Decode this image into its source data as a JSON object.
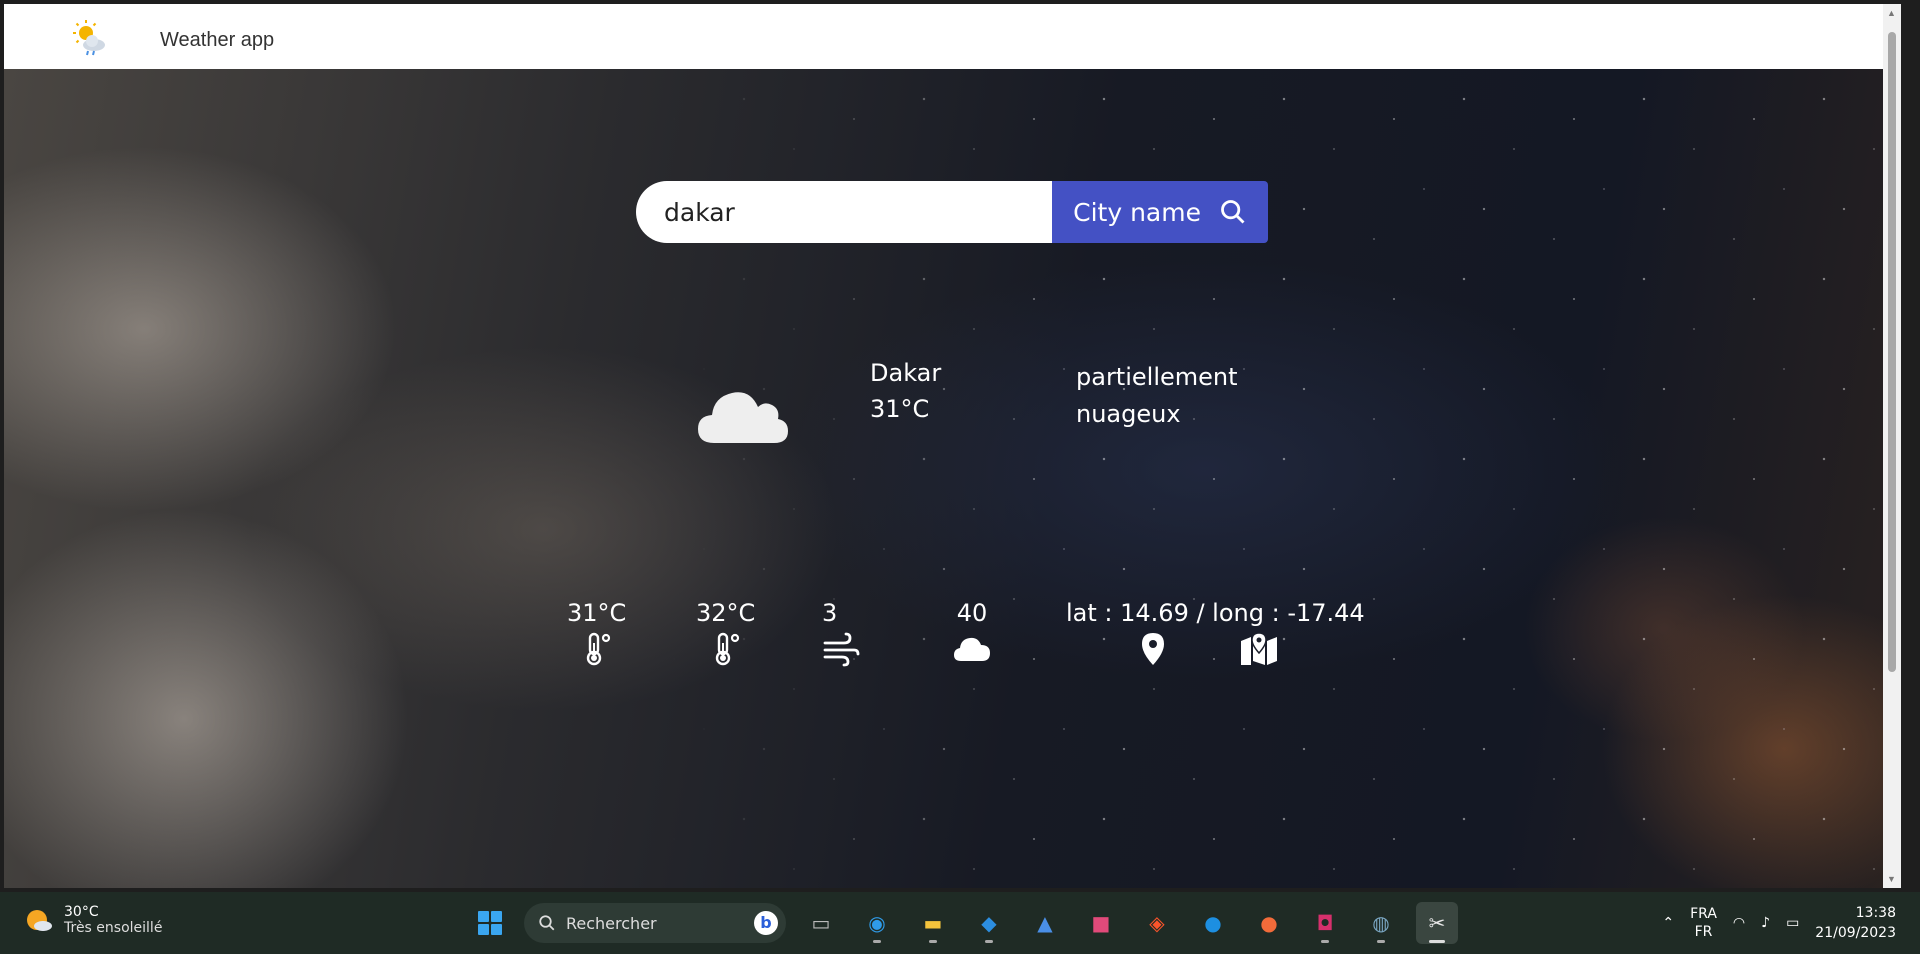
{
  "header": {
    "title": "Weather app",
    "logo_icon": "sun-cloud-icon"
  },
  "search": {
    "value": "dakar",
    "button_label": "City name",
    "button_color": "#4451c4"
  },
  "current": {
    "city": "Dakar",
    "temperature": "31°C",
    "description": "partiellement nuageux",
    "icon": "cloud-icon"
  },
  "stats": {
    "temp_min": "31°C",
    "temp_max": "32°C",
    "wind": "3",
    "clouds": "40",
    "coords": "lat : 14.69 / long : -17.44"
  },
  "taskbar": {
    "weather_temp": "30°C",
    "weather_text": "Très ensoleillé",
    "search_placeholder": "Rechercher",
    "lang_top": "FRA",
    "lang_bottom": "FR",
    "time": "13:38",
    "date": "21/09/2023"
  }
}
